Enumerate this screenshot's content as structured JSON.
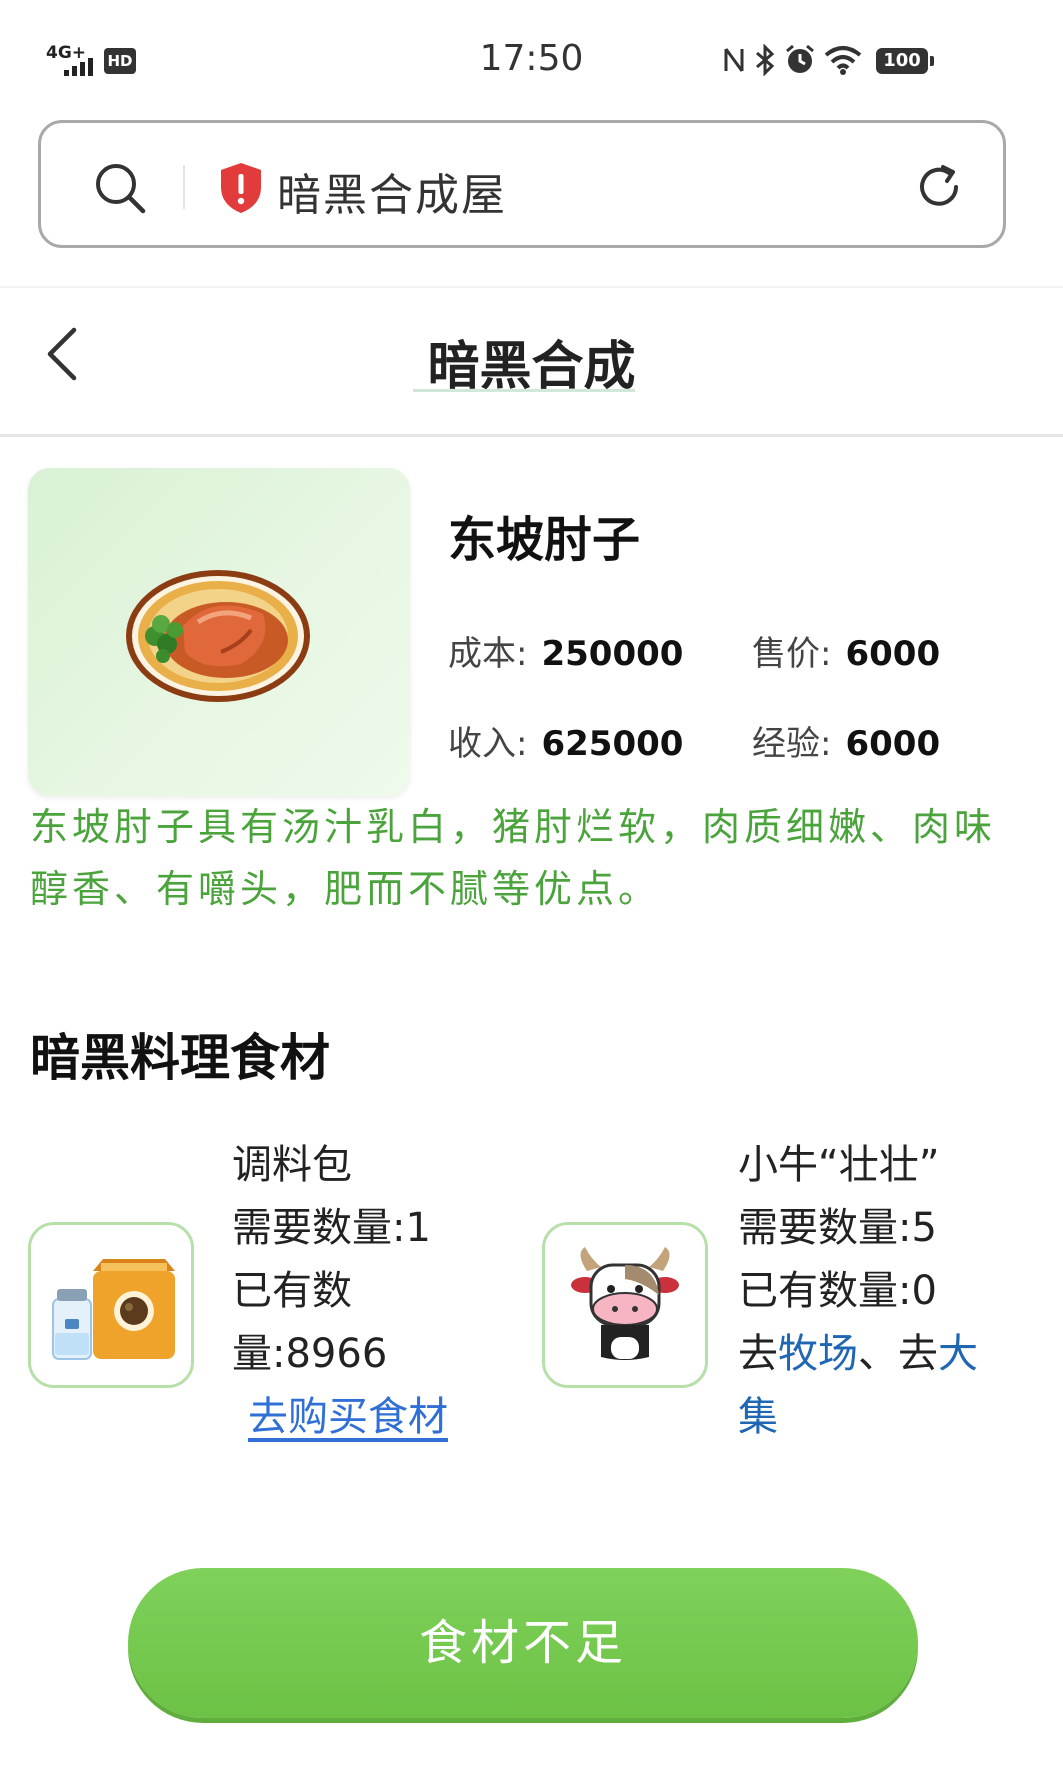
{
  "status_bar": {
    "network": "4G+",
    "hd": "HD",
    "time": "17:50",
    "battery": "100",
    "icons": [
      "nfc-icon",
      "bluetooth-icon",
      "alarm-icon",
      "wifi-icon",
      "battery-icon"
    ]
  },
  "browser": {
    "site_title": "暗黑合成屋",
    "icons": [
      "search-icon",
      "shield-icon",
      "reload-icon"
    ]
  },
  "page": {
    "title": "暗黑合成"
  },
  "dish": {
    "name": "东坡肘子",
    "cost_label": "成本:",
    "cost_value": "250000",
    "price_label": "售价:",
    "price_value": "6000",
    "income_label": "收入:",
    "income_value": "625000",
    "exp_label": "经验:",
    "exp_value": "6000",
    "description": "东坡肘子具有汤汁乳白，猪肘烂软，肉质细嫩、肉味醇香、有嚼头，肥而不腻等优点。"
  },
  "ingredients_section": {
    "title": "暗黑料理食材",
    "items": [
      {
        "name": "调料包",
        "need_label": "需要数量:1",
        "have_label_1": "已有数",
        "have_label_2": "量:8966",
        "action": "去购买食材"
      },
      {
        "name": "小牛“壮壮”",
        "need_label": "需要数量:5",
        "have_label": "已有数量:0",
        "go_prefix_1": "去",
        "link_ranch": "牧场",
        "go_sep": "、去",
        "link_market_1": "大",
        "link_market_2": "集"
      }
    ]
  },
  "bottom_button": {
    "label": "食材不足"
  },
  "colors": {
    "accent_green": "#6cc245",
    "desc_green": "#4aa33b",
    "link_blue": "#2f6fd6"
  }
}
